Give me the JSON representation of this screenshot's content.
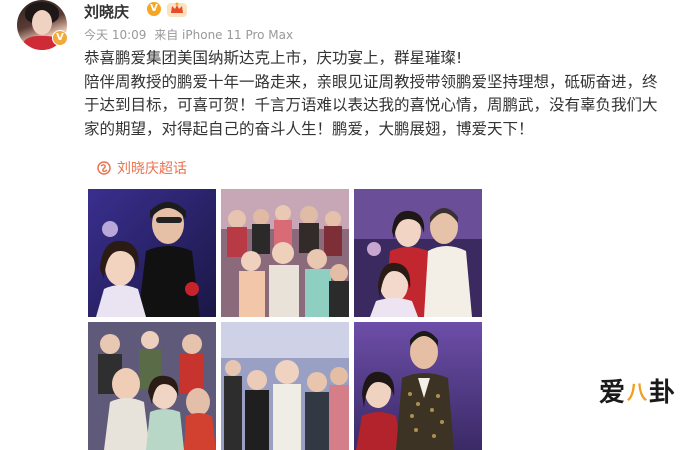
{
  "user": {
    "name": "刘晓庆",
    "avatar_icon": "user-avatar",
    "verified_icon": "verified-v-badge",
    "vip_icon": "vip-v-icon",
    "crown_icon": "crown-member-icon"
  },
  "post": {
    "time": "今天 10:09",
    "source": "来自 iPhone 11 Pro Max",
    "paragraphs": [
      "恭喜鹏爱集团美国纳斯达克上市，庆功宴上，群星璀璨!",
      "陪伴周教授的鹏爱十年一路走来，亲眼见证周教授带领鹏爱坚持理想，砥砺奋进，终于达到目标，可喜可贺！千言万语难以表达我的喜悦心情，周鹏武，没有辜负我们大家的期望，对得起自己的奋斗人生！鹏爱，大鹏展翅，博爱天下！"
    ],
    "topic": "刘晓庆超话",
    "topic_icon": "super-topic-icon"
  },
  "photos": [
    {
      "name": "photo-1",
      "scene": "banquet-couple-purple"
    },
    {
      "name": "photo-2",
      "scene": "crowd-group"
    },
    {
      "name": "photo-3",
      "scene": "couple-red-jacket"
    },
    {
      "name": "photo-4",
      "scene": "group-stage"
    },
    {
      "name": "photo-5",
      "scene": "group-banquet"
    },
    {
      "name": "photo-6",
      "scene": "man-sequin-jacket"
    }
  ],
  "watermark": {
    "left": "爱",
    "mid": "八",
    "right": "卦"
  },
  "colors": {
    "link": "#eb7350",
    "meta": "#999999",
    "text": "#333333",
    "badge": "#f5a623"
  }
}
